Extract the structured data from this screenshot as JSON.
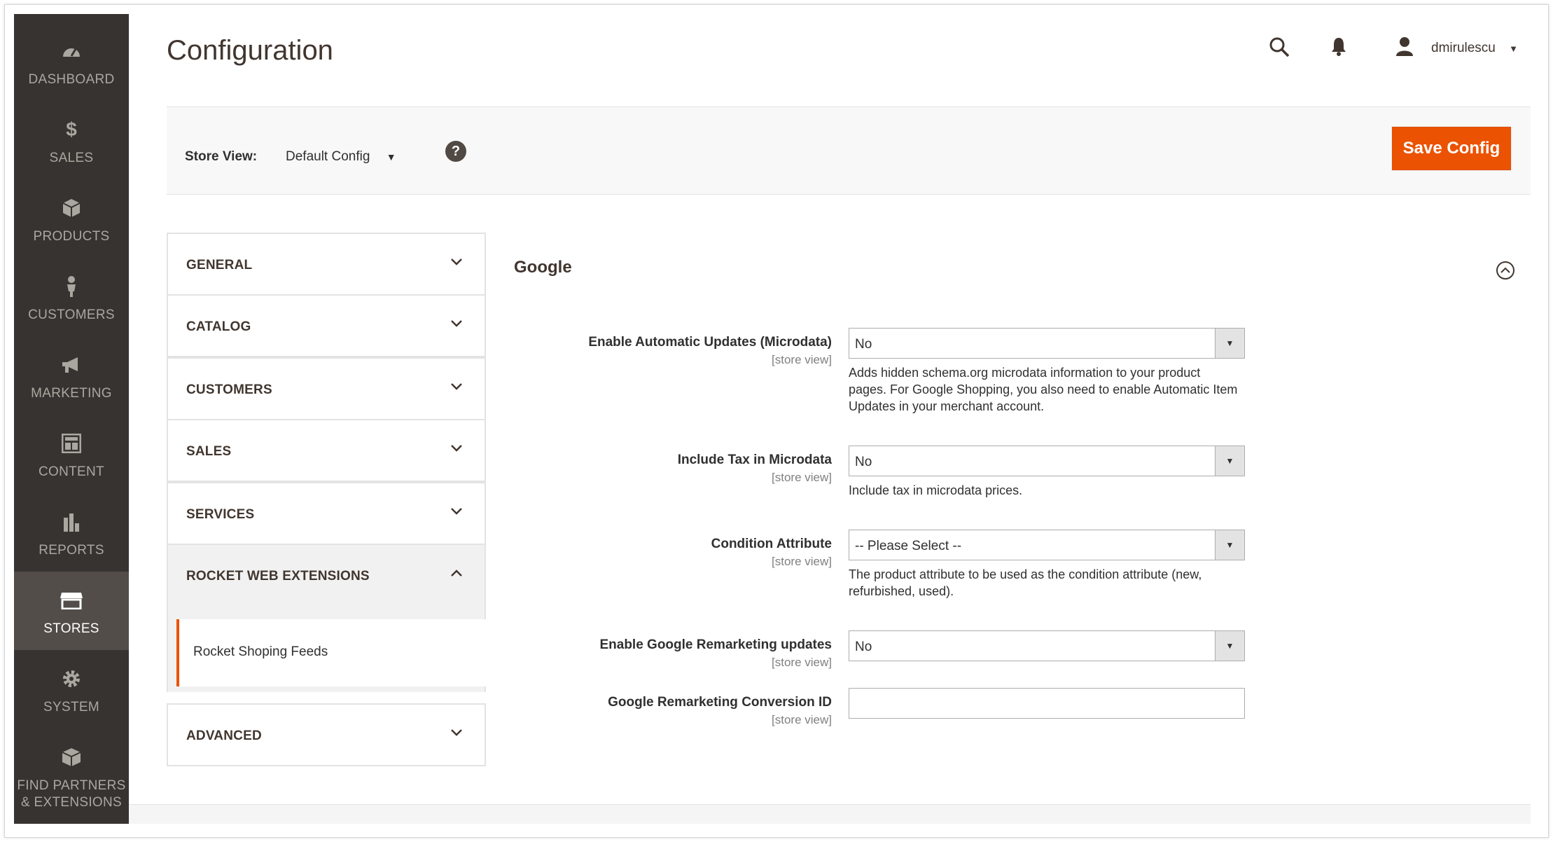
{
  "nav": [
    {
      "label": "DASHBOARD",
      "icon": "dashboard-icon"
    },
    {
      "label": "$ SALES",
      "icon": "dollar-icon"
    },
    {
      "label": "PRODUCTS",
      "icon": "box-icon"
    },
    {
      "label": "CUSTOMERS",
      "icon": "person-icon"
    },
    {
      "label": "MARKETING",
      "icon": "megaphone-icon"
    },
    {
      "label": "CONTENT",
      "icon": "layout-icon"
    },
    {
      "label": "REPORTS",
      "icon": "bar-chart-icon"
    },
    {
      "label": "STORES",
      "icon": "storefront-icon"
    },
    {
      "label": "SYSTEM",
      "icon": "gear-icon"
    },
    {
      "label": "FIND PARTNERS & EXTENSIONS",
      "icon": "cube-icon"
    }
  ],
  "header": {
    "title": "Configuration",
    "username": "dmirulescu"
  },
  "store_bar": {
    "label": "Store View:",
    "selected": "Default Config",
    "help": "?",
    "save_label": "Save Config"
  },
  "tabs": [
    {
      "label": "GENERAL"
    },
    {
      "label": "CATALOG"
    },
    {
      "label": "CUSTOMERS"
    },
    {
      "label": "SALES"
    },
    {
      "label": "SERVICES"
    },
    {
      "label": "ROCKET WEB EXTENSIONS",
      "subitem": "Rocket Shoping Feeds"
    },
    {
      "label": "ADVANCED"
    }
  ],
  "section": {
    "title": "Google",
    "fields": [
      {
        "label": "Enable Automatic Updates (Microdata)",
        "scope": "[store view]",
        "value": "No",
        "note": "Adds hidden schema.org microdata information to your product pages. For Google Shopping, you also need to enable Automatic Item Updates in your merchant account."
      },
      {
        "label": "Include Tax in Microdata",
        "scope": "[store view]",
        "value": "No",
        "note": "Include tax in microdata prices."
      },
      {
        "label": "Condition Attribute",
        "scope": "[store view]",
        "value": "-- Please Select --",
        "note": "The product attribute to be used as the condition attribute (new, refurbished, used)."
      },
      {
        "label": "Enable Google Remarketing updates",
        "scope": "[store view]",
        "value": "No"
      },
      {
        "label": "Google Remarketing Conversion ID",
        "scope": "[store view]",
        "value": ""
      }
    ]
  },
  "colors": {
    "sidebar_bg": "#373330",
    "sidebar_active": "#524d49",
    "accent": "#eb5202"
  }
}
